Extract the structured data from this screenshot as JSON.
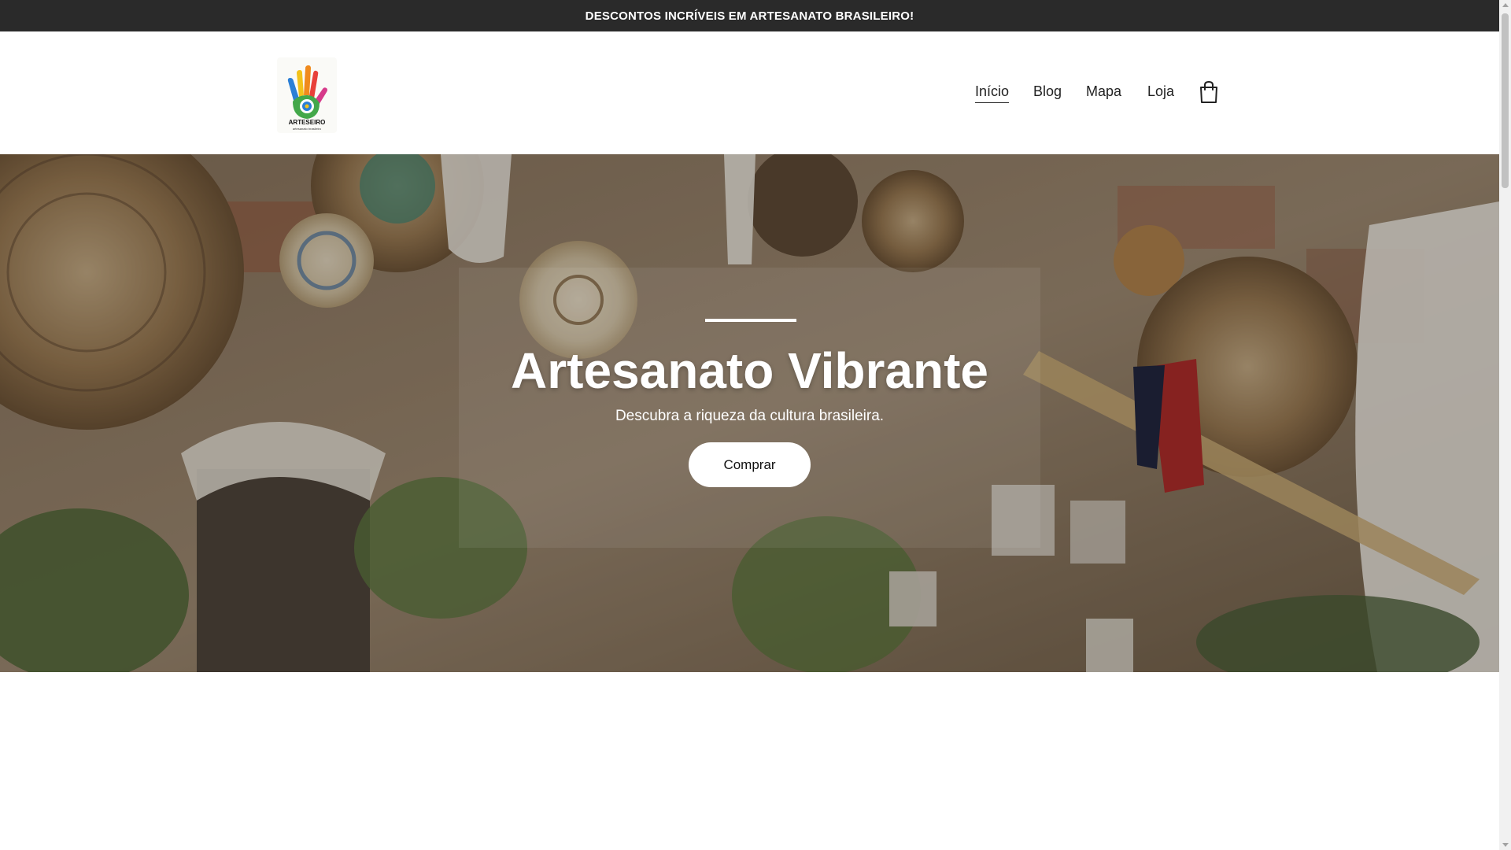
{
  "announcement": {
    "text": "DESCONTOS INCRÍVEIS EM ARTESANATO BRASILEIRO!"
  },
  "header": {
    "logo": {
      "wordmark": "ARTESEIRO",
      "tagline": "artesanato brasileiro",
      "icon": "painted-hand-logo"
    },
    "nav": [
      {
        "label": "Início",
        "active": true
      },
      {
        "label": "Blog",
        "active": false
      },
      {
        "label": "Mapa",
        "active": false
      },
      {
        "label": "Loja",
        "active": false
      }
    ],
    "cart_icon": "shopping-bag-icon"
  },
  "hero": {
    "title": "Artesanato Vibrante",
    "subtitle": "Descubra a riqueza da cultura brasileira.",
    "button_label": "Comprar",
    "background": "wall-of-handicraft-baskets-photo"
  },
  "colors": {
    "announcement_bg": "#2a2a2a",
    "hero_text": "#ffffff",
    "button_bg": "#ffffff",
    "nav_text": "#222222"
  }
}
